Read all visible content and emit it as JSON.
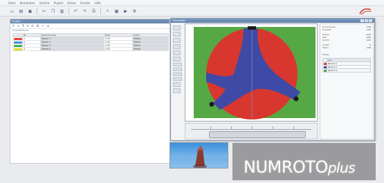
{
  "menu": [
    "Datei",
    "Bearbeiten",
    "Ansicht",
    "Projekt",
    "Extras",
    "Fenster",
    "Hilfe"
  ],
  "toolbar": {
    "icons": [
      "new-icon",
      "open-icon",
      "save-icon",
      "cut-icon",
      "copy-icon",
      "paste-icon",
      "undo-icon",
      "redo-icon",
      "print-icon",
      "zoom-icon",
      "grid-icon",
      "play-icon",
      "settings-icon"
    ]
  },
  "left_panel": {
    "title": "Projekt",
    "tools": [
      "X",
      "↕",
      "¶",
      "V",
      "Ω",
      "W",
      "↶",
      "⊕"
    ],
    "caption": "Auswahlfarbe",
    "columns": [
      "",
      "Nr",
      "Bezeichnung",
      "Wert",
      "Anteil"
    ],
    "rows": [
      {
        "color": "#e8413c",
        "nr": "1",
        "label": "Ebene 1",
        "value": "0.00",
        "note": "Fläche"
      },
      {
        "color": "#3d8fe0",
        "nr": "2",
        "label": "Ebene 2",
        "value": "0.00",
        "note": "Fläche"
      },
      {
        "color": "#38b24a",
        "nr": "3",
        "label": "Ebene 3",
        "value": "0.00",
        "note": "Fläche"
      },
      {
        "color": "#e7d52b",
        "nr": "4",
        "label": "Ebene 4",
        "value": "0.00",
        "note": "Fläche"
      }
    ]
  },
  "sim_window": {
    "title": "Simulation",
    "colors": {
      "background": "#56a844",
      "outer": "#d8372f",
      "inner": "#3f4aa6"
    },
    "properties": [
      {
        "k": "Durchmesser",
        "v": "3.00"
      },
      {
        "k": "Drehzahl",
        "v": "1.00"
      },
      {
        "k": "Winkel",
        "v": "0.00"
      },
      {
        "k": "Zeit",
        "v": "0.00"
      },
      {
        "k": "Schritt",
        "v": "1.00"
      },
      {
        "k": "Anzahl",
        "v": "3"
      },
      {
        "k": "Faktor",
        "v": "1.00"
      }
    ],
    "legend_title": "Farben",
    "legend": [
      {
        "color": "#ffffff",
        "label": "aus"
      },
      {
        "color": "#d8372f",
        "label": "Bereich 1"
      },
      {
        "color": "#3f4aa6",
        "label": "Bereich 2"
      },
      {
        "color": "#56a844",
        "label": "Bereich 3"
      }
    ]
  },
  "brand": {
    "text": "NUMROTO",
    "suffix": "plus"
  }
}
